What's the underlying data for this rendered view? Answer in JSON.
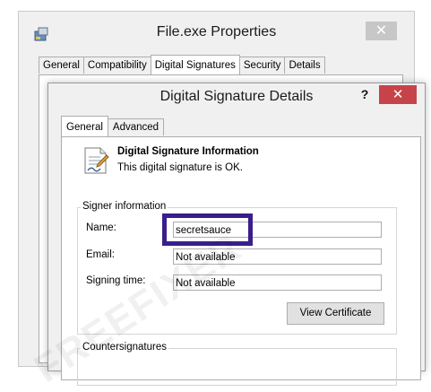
{
  "outer_window": {
    "title": "File.exe Properties",
    "close_glyph": "✕",
    "tabs": [
      "General",
      "Compatibility",
      "Digital Signatures",
      "Security",
      "Details"
    ],
    "active_tab": "Digital Signatures"
  },
  "dialog": {
    "title": "Digital Signature Details",
    "help_glyph": "?",
    "close_glyph": "✕",
    "tabs": [
      "General",
      "Advanced"
    ],
    "active_tab": "General",
    "info_heading": "Digital Signature Information",
    "info_text": "This digital signature is OK.",
    "signer_group_label": "Signer information",
    "fields": {
      "name_label": "Name:",
      "name_value": "secretsauce",
      "email_label": "Email:",
      "email_value": "Not available",
      "signing_time_label": "Signing time:",
      "signing_time_value": "Not available"
    },
    "view_certificate_label": "View Certificate",
    "countersignatures_label": "Countersignatures"
  },
  "watermark": "FREEFIXER",
  "colors": {
    "highlight_border": "#3a1e8c",
    "dialog_close_bg": "#c7434a",
    "outer_close_bg": "#c7c7c7"
  }
}
